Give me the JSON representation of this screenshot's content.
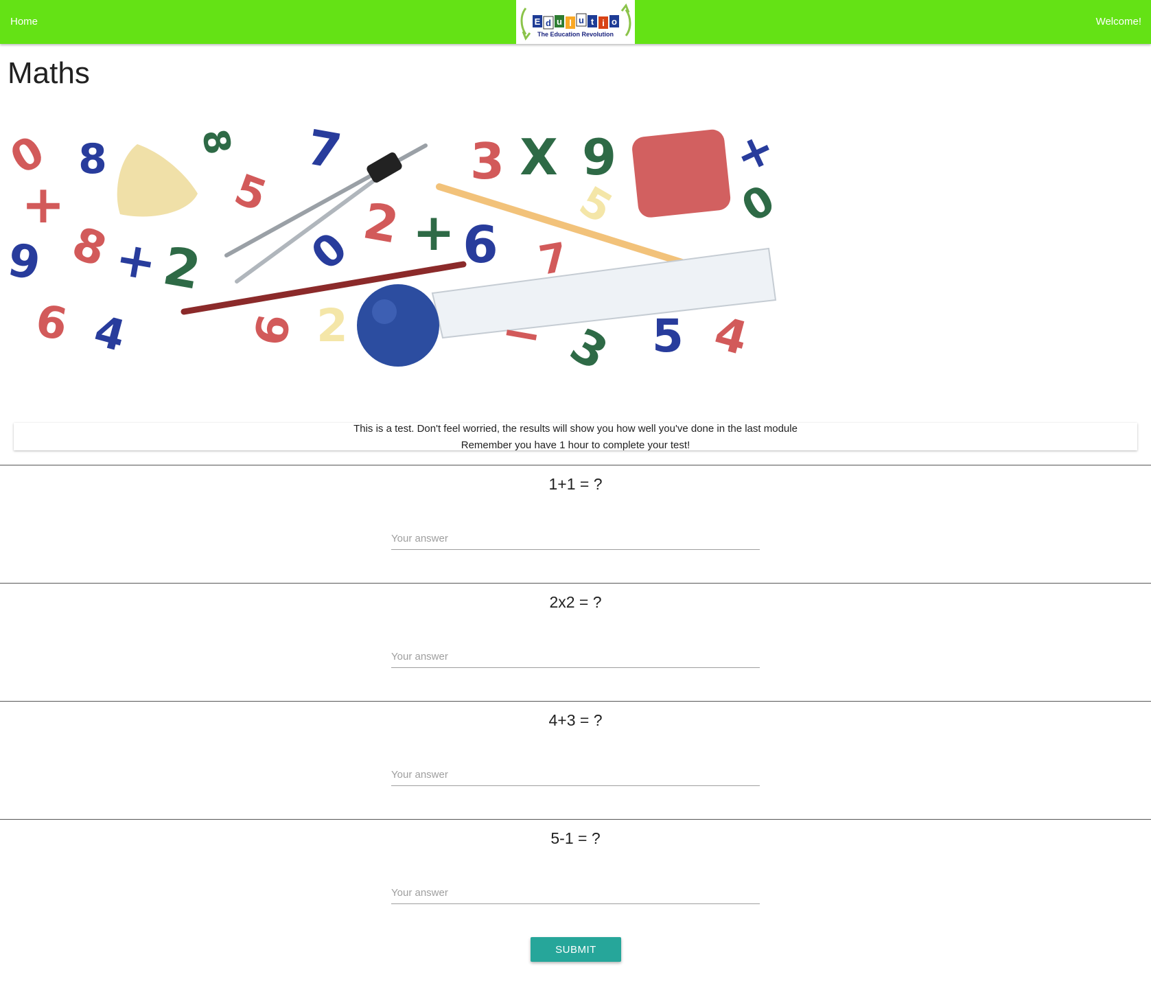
{
  "nav": {
    "home_label": "Home",
    "welcome_label": "Welcome!",
    "logo_text": "Edulution",
    "logo_tagline": "The Education Revolution"
  },
  "page": {
    "title": "Maths"
  },
  "hero": {
    "glyphs": [
      "0",
      "8",
      "8",
      "5",
      "7",
      "3",
      "X",
      "9",
      "+",
      "+",
      "8",
      "+",
      "2",
      "9",
      "0",
      "2",
      "+",
      "6",
      "5",
      "7",
      "0",
      "6",
      "4",
      "6",
      "2",
      "−",
      "3",
      "5",
      "4"
    ]
  },
  "info": {
    "line1": "This is a test. Don't feel worried, the results will show you how well you've done in the last module",
    "line2": "Remember you have 1 hour to complete your test!"
  },
  "questions": [
    {
      "text": "1+1 = ?",
      "placeholder": "Your answer",
      "value": ""
    },
    {
      "text": "2x2 = ?",
      "placeholder": "Your answer",
      "value": ""
    },
    {
      "text": "4+3 = ?",
      "placeholder": "Your answer",
      "value": ""
    },
    {
      "text": "5-1 = ?",
      "placeholder": "Your answer",
      "value": ""
    }
  ],
  "submit_label": "SUBMIT",
  "colors": {
    "navbar": "#64e215",
    "submit": "#26a69a",
    "hero_red": "#d25a5a",
    "hero_blue": "#283c9c",
    "hero_green": "#2e6a46",
    "hero_cream": "#f4e6a8"
  }
}
